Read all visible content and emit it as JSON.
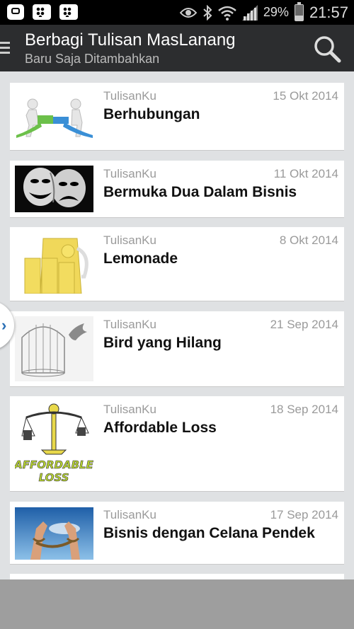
{
  "status_bar": {
    "battery_percent": "29%",
    "time": "21:57",
    "icons": [
      "app-icon",
      "bbm-icon",
      "bbm-icon",
      "eye-icon",
      "bluetooth-icon",
      "wifi-icon",
      "signal-icon",
      "battery-icon"
    ]
  },
  "action_bar": {
    "title": "Berbagi Tulisan MasLanang",
    "subtitle": "Baru Saja Ditambahkan"
  },
  "articles": [
    {
      "category": "TulisanKu",
      "date": "15 Okt 2014",
      "title": "Berhubungan"
    },
    {
      "category": "TulisanKu",
      "date": "11 Okt 2014",
      "title": "Bermuka Dua Dalam Bisnis"
    },
    {
      "category": "TulisanKu",
      "date": "8 Okt 2014",
      "title": "Lemonade"
    },
    {
      "category": "TulisanKu",
      "date": "21 Sep 2014",
      "title": "Bird yang Hilang"
    },
    {
      "category": "TulisanKu",
      "date": "18 Sep 2014",
      "title": "Affordable Loss"
    },
    {
      "category": "TulisanKu",
      "date": "17 Sep 2014",
      "title": "Bisnis dengan Celana Pendek"
    }
  ],
  "thumbnail_texts": {
    "affordable": [
      "AFFORDABLE",
      "LOSS"
    ]
  },
  "colors": {
    "action_bar": "#2c2d2f",
    "list_background": "#dfe1e3",
    "card": "#ffffff",
    "pull_tab_arrow": "#2a6fb5"
  }
}
